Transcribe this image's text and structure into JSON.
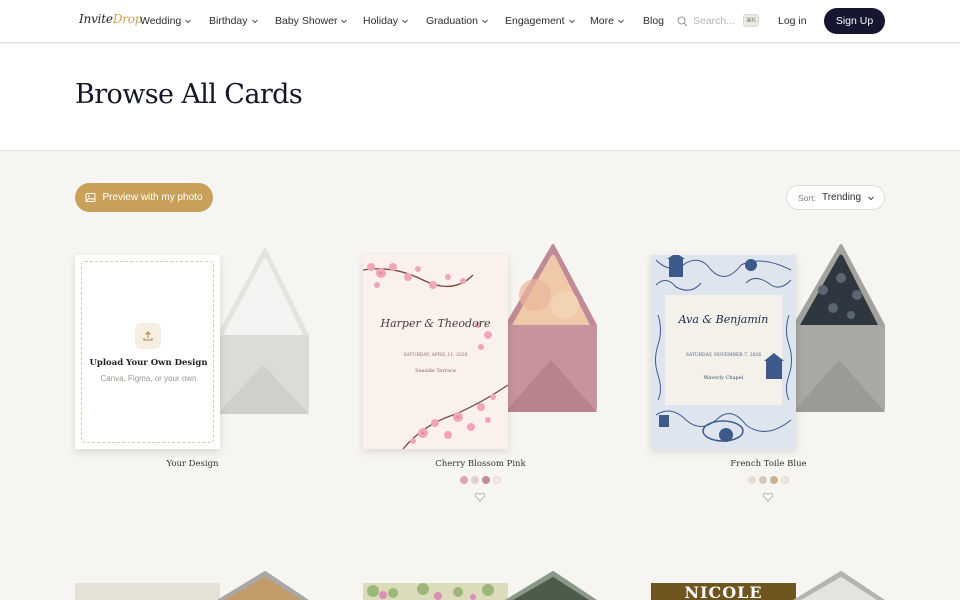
{
  "nav": {
    "logo_text_a": "Invite",
    "logo_text_b": "Drop",
    "items": [
      {
        "label": "Wedding",
        "dropdown": true
      },
      {
        "label": "Birthday",
        "dropdown": true
      },
      {
        "label": "Baby Shower",
        "dropdown": true
      },
      {
        "label": "Holiday",
        "dropdown": true
      },
      {
        "label": "Graduation",
        "dropdown": true
      },
      {
        "label": "Engagement",
        "dropdown": true
      },
      {
        "label": "More",
        "dropdown": true
      },
      {
        "label": "Blog",
        "dropdown": false
      }
    ],
    "search_placeholder": "Search...",
    "search_shortcut": "⌘K",
    "login": "Log in",
    "signup": "Sign Up"
  },
  "hero": {
    "title": "Browse All Cards"
  },
  "controls": {
    "preview_button": "Preview with my photo",
    "sort_label": "Sort:",
    "sort_value": "Trending"
  },
  "cards": [
    {
      "title": "Your Design",
      "upload_title": "Upload Your Own Design",
      "upload_subtitle": "Canva, Figma, or your own"
    },
    {
      "title": "Cherry Blossom Pink",
      "names": "Harper & Theodore",
      "date": "SATURDAY, APRIL 11, 2026",
      "venue": "Seaside Terrace",
      "swatches": [
        "#d9a9ae",
        "#e7cfcf",
        "#c08d98",
        "#f4e7e6"
      ],
      "selected_swatch": 2
    },
    {
      "title": "French Toile Blue",
      "names": "Ava & Benjamin",
      "date": "SATURDAY, NOVEMBER 7, 2026",
      "venue": "Waverly Chapel",
      "swatches": [
        "#e6ddd0",
        "#d6c9b8",
        "#c9b291",
        "#efe7dc"
      ],
      "selected_swatch": 2
    }
  ],
  "row2_overlay_text": "NICOLE",
  "colors": {
    "brand_dark": "#161630",
    "accent_gold": "#c9a05a",
    "background": "#f7f5f1"
  }
}
